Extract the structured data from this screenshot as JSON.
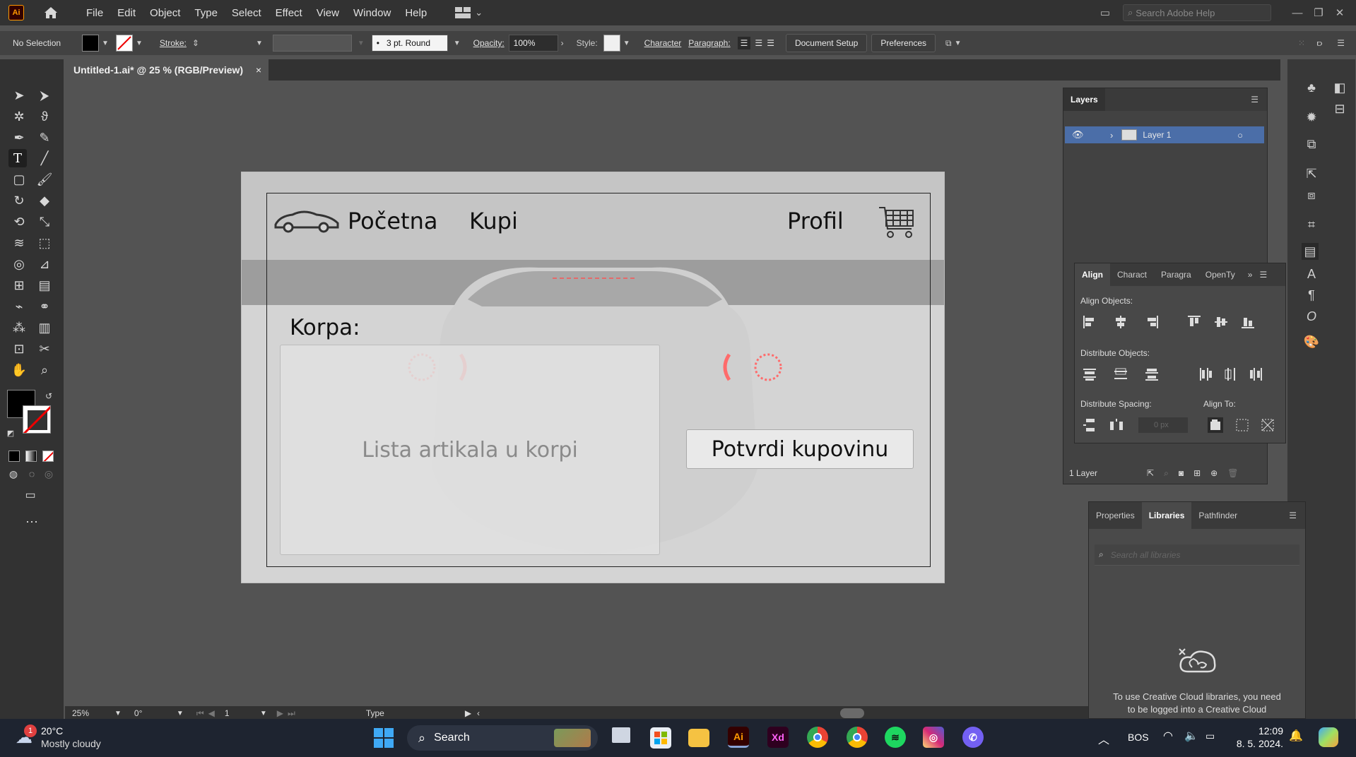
{
  "app": {
    "logo": "Ai"
  },
  "menu": [
    "File",
    "Edit",
    "Object",
    "Type",
    "Select",
    "Effect",
    "View",
    "Window",
    "Help"
  ],
  "search_help_placeholder": "Search Adobe Help",
  "control": {
    "selection": "No Selection",
    "stroke_label": "Stroke:",
    "brush": "3 pt. Round",
    "opacity_label": "Opacity:",
    "opacity_value": "100%",
    "style_label": "Style:",
    "character": "Character",
    "paragraph": "Paragraph:",
    "doc_setup": "Document Setup",
    "preferences": "Preferences"
  },
  "doc_tab": {
    "title": "Untitled-1.ai* @ 25 % (RGB/Preview)",
    "close": "×"
  },
  "artboard": {
    "nav_home": "Početna",
    "nav_buy": "Kupi",
    "nav_profile": "Profil",
    "cart_heading": "Korpa:",
    "cart_list": "Lista artikala u korpi",
    "confirm": "Potvrdi kupovinu"
  },
  "status": {
    "zoom": "25%",
    "rotate": "0°",
    "page": "1",
    "tool": "Type"
  },
  "layers": {
    "title": "Layers",
    "layer_name": "Layer 1",
    "footer": "1 Layer"
  },
  "align": {
    "tabs": [
      "Align",
      "Charact",
      "Paragra",
      "OpenTy"
    ],
    "align_objects": "Align Objects:",
    "distribute_objects": "Distribute Objects:",
    "distribute_spacing": "Distribute Spacing:",
    "align_to": "Align To:",
    "spacing_value": "0 px"
  },
  "libraries": {
    "tabs": [
      "Properties",
      "Libraries",
      "Pathfinder"
    ],
    "search_placeholder": "Search all libraries",
    "message_line1": "To use Creative Cloud libraries, you need",
    "message_line2": "to be logged into a Creative Cloud"
  },
  "taskbar": {
    "weather_temp": "20°C",
    "weather_desc": "Mostly cloudy",
    "weather_badge": "1",
    "search": "Search",
    "lang": "BOS",
    "time": "12:09",
    "date": "8. 5. 2024.",
    "apps": [
      "Ai",
      "Xd"
    ]
  },
  "colors": {
    "accent": "#ff9a00",
    "taskbar": "#1e2430",
    "selection_blue": "#4b6ea8"
  }
}
